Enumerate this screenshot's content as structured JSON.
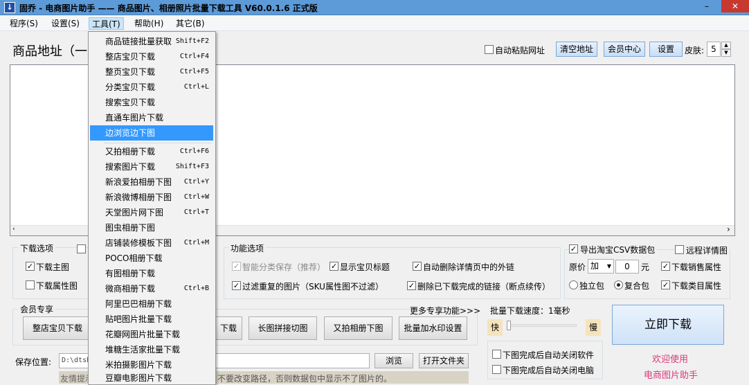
{
  "window": {
    "title": "固乔 - 电商图片助手 —— 商品图片、相册照片批量下载工具 V60.0.1.6 正式版",
    "min": "–",
    "max": "□",
    "close": "✕"
  },
  "menu": [
    "程序(S)",
    "设置(S)",
    "工具(T)",
    "帮助(H)",
    "其它(B)"
  ],
  "dropdown": [
    {
      "label": "商品链接批量获取",
      "key": "Shift+F2"
    },
    {
      "label": "整店宝贝下载",
      "key": "Ctrl+F4"
    },
    {
      "label": "整页宝贝下载",
      "key": "Ctrl+F5"
    },
    {
      "label": "分类宝贝下载",
      "key": "Ctrl+L"
    },
    {
      "label": "搜索宝贝下载",
      "key": ""
    },
    {
      "label": "直通车图片下载",
      "key": ""
    },
    {
      "label": "边浏览边下图",
      "key": ""
    },
    {
      "label": "又拍相册下载",
      "key": "Ctrl+F6"
    },
    {
      "label": "搜索图片下载",
      "key": "Shift+F3"
    },
    {
      "label": "新浪爱拍相册下图",
      "key": "Ctrl+Y"
    },
    {
      "label": "新浪微博相册下图",
      "key": "Ctrl+W"
    },
    {
      "label": "天堂图片网下图",
      "key": "Ctrl+T"
    },
    {
      "label": "图虫相册下图",
      "key": ""
    },
    {
      "label": "店铺装修模板下图",
      "key": "Ctrl+M"
    },
    {
      "label": "POCO相册下载",
      "key": ""
    },
    {
      "label": "有图相册下载",
      "key": ""
    },
    {
      "label": "微商相册下载",
      "key": "Ctrl+B"
    },
    {
      "label": "阿里巴巴相册下载",
      "key": ""
    },
    {
      "label": "贴吧图片批量下载",
      "key": ""
    },
    {
      "label": "花瓣网图片批量下载",
      "key": ""
    },
    {
      "label": "堆糖生活家批量下载",
      "key": ""
    },
    {
      "label": "米拍摄影图片下载",
      "key": ""
    },
    {
      "label": "豆瓣电影图片下载",
      "key": ""
    }
  ],
  "address": {
    "label": "商品地址（一",
    "auto_paste": "自动粘贴网址",
    "clear": "清空地址",
    "member": "会员中心",
    "settings": "设置",
    "skin_label": "皮肤:",
    "skin_value": "5"
  },
  "download_options": {
    "title": "下载选项",
    "main_image": "下载主图",
    "attr_image": "下载属性图"
  },
  "function_options": {
    "title": "功能选项",
    "smart_save": "智能分类保存（推荐）",
    "show_title": "显示宝贝标题",
    "auto_delete_links": "自动删除详情页中的外链",
    "filter_dup": "过滤重复的图片（SKU属性图不过滤）",
    "delete_done": "删除已下载完成的链接（断点续传）"
  },
  "csv": {
    "export": "导出淘宝CSV数据包",
    "remote_detail": "远程详情图",
    "price_label": "原价",
    "op_value": "加",
    "num_value": "0",
    "unit": "元",
    "sales_attr": "下载销售属性",
    "standalone": "独立包",
    "composite": "复合包",
    "category_attr": "下载类目属性"
  },
  "member": {
    "title": "会员专享",
    "more": "更多专享功能>>>",
    "btn_shop": "整店宝贝下载",
    "btn_download": "下载",
    "btn_long": "长图拼接切图",
    "btn_youpai": "又拍相册下图",
    "btn_watermark": "批量加水印设置"
  },
  "batch": {
    "speed": "批量下载速度：1毫秒",
    "fast": "快",
    "slow": "慢",
    "close_app": "下图完成后自动关闭软件",
    "shutdown": "下图完成后自动关闭电脑"
  },
  "start_button": "立即下载",
  "welcome": [
    "欢迎使用",
    "电商图片助手"
  ],
  "save": {
    "label": "保存位置:",
    "path": "D:\\dtsh",
    "browse": "浏览",
    "open": "打开文件夹",
    "tip_left": "友情提示",
    "tip_right": "不要改变路径，否则数据包中显示不了图片的。"
  }
}
